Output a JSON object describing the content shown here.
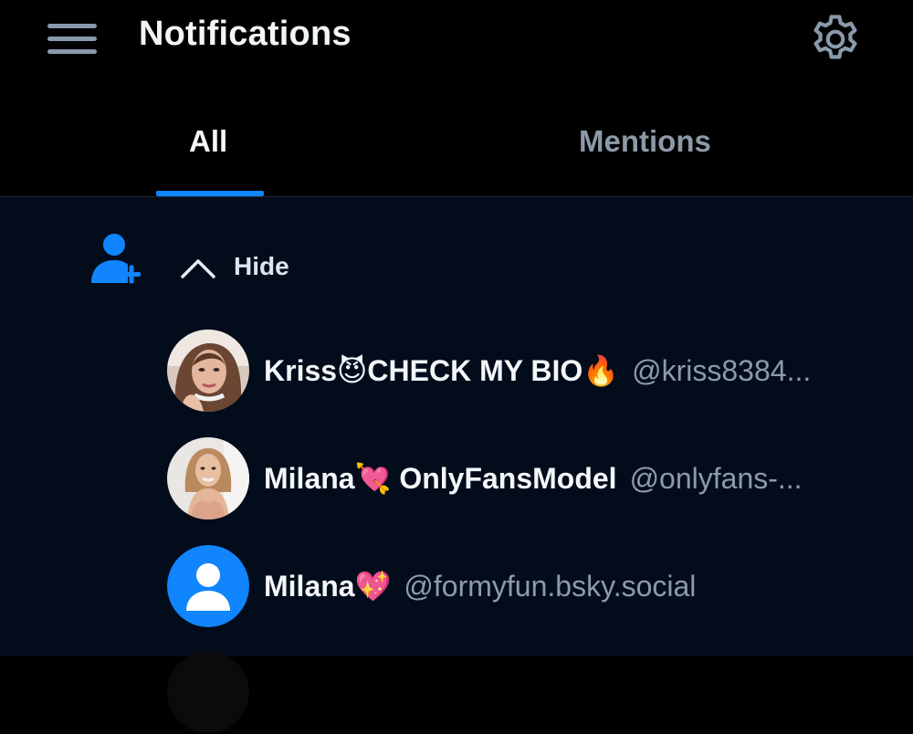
{
  "header": {
    "title": "Notifications",
    "menu_icon": "hamburger-menu-icon",
    "settings_icon": "gear-icon"
  },
  "tabs": [
    {
      "label": "All",
      "active": true
    },
    {
      "label": "Mentions",
      "active": false
    }
  ],
  "colors": {
    "accent": "#1085fe",
    "background": "#030c1b",
    "header_background": "#000000",
    "secondary_text": "#8d9aab"
  },
  "follow_group": {
    "icon": "person-add-icon",
    "toggle_icon": "chevron-up-icon",
    "toggle_label": "Hide",
    "users": [
      {
        "display_name": "Kriss😈CHECK MY BIO🔥",
        "handle": "@kriss8384...",
        "avatar": "photo-avatar"
      },
      {
        "display_name": "Milana💘 OnlyFansModel",
        "handle": "@onlyfans-...",
        "avatar": "photo-avatar"
      },
      {
        "display_name": "Milana💖",
        "handle": "@formyfun.bsky.social",
        "avatar": "default-avatar-icon"
      }
    ]
  }
}
